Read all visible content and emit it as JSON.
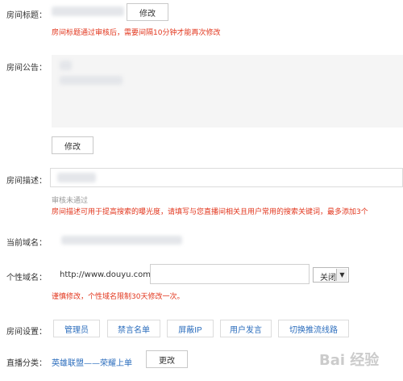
{
  "room_title": {
    "label": "房间标题：",
    "modify_button": "修改",
    "notice": "房间标题通过审核后，需要间隔10分钟才能再次修改"
  },
  "room_announcement": {
    "label": "房间公告：",
    "modify_button": "修改"
  },
  "room_description": {
    "label": "房间描述：",
    "status": "审核未通过",
    "notice": "房间描述可用于提高搜索的曝光度，请填写与您直播间相关且用户常用的搜索关键词，最多添加3个"
  },
  "current_domain": {
    "label": "当前域名："
  },
  "custom_domain": {
    "label": "个性域名：",
    "prefix": "http://www.douyu.com/",
    "value": "",
    "select_value": "关闭",
    "notice": "谨慎修改，个性域名限制30天修改一次。"
  },
  "room_settings": {
    "label": "房间设置：",
    "buttons": [
      "管理员",
      "禁言名单",
      "屏蔽IP",
      "用户发言",
      "切换推流线路"
    ]
  },
  "live_category": {
    "label": "直播分类：",
    "value": "英雄联盟——荣耀上单",
    "change_button": "更改"
  },
  "watermark": {
    "text": "Bai 经验"
  },
  "colors": {
    "warning": "#e2361d",
    "link": "#2b6dbd",
    "muted": "#999999"
  }
}
